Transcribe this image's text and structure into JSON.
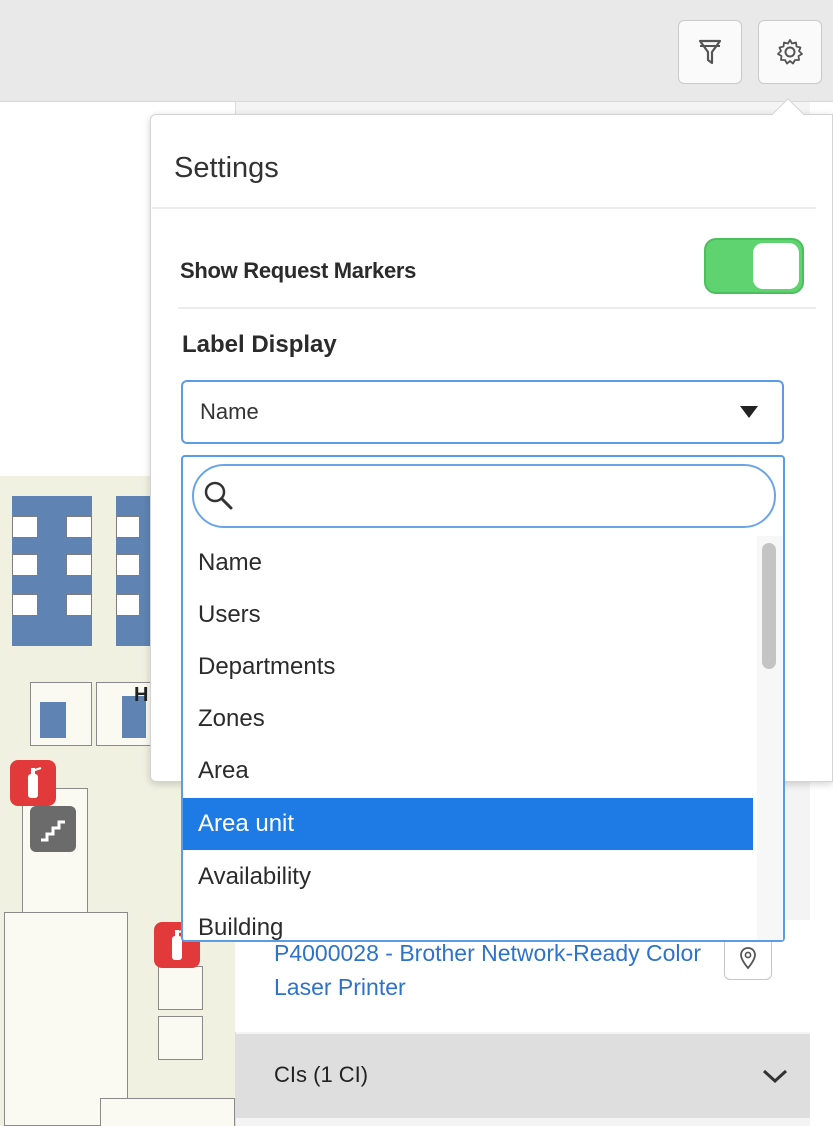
{
  "toolbar": {
    "filter_icon": "filter-icon",
    "settings_icon": "gear-icon"
  },
  "settings": {
    "title": "Settings",
    "show_request_markers": {
      "label": "Show Request Markers",
      "enabled": true,
      "on_color": "#5fd36f"
    },
    "label_display": {
      "label": "Label Display",
      "selected_value": "Name",
      "search_placeholder": "",
      "options": [
        "Name",
        "Users",
        "Departments",
        "Zones",
        "Area",
        "Area unit",
        "Availability",
        "Building"
      ],
      "highlighted_option": "Area unit",
      "highlight_color": "#1e7be6"
    }
  },
  "map": {
    "room_label": "H"
  },
  "side_panel": {
    "asset_link": "P4000028 - Brother Network-Ready Color Laser Printer",
    "cis_section": "CIs (1 CI)"
  },
  "colors": {
    "accent_blue": "#5b9ce6",
    "link_blue": "#2f73c9",
    "desk_blue": "#5f84b3",
    "extinguisher_red": "#e23a3a"
  }
}
